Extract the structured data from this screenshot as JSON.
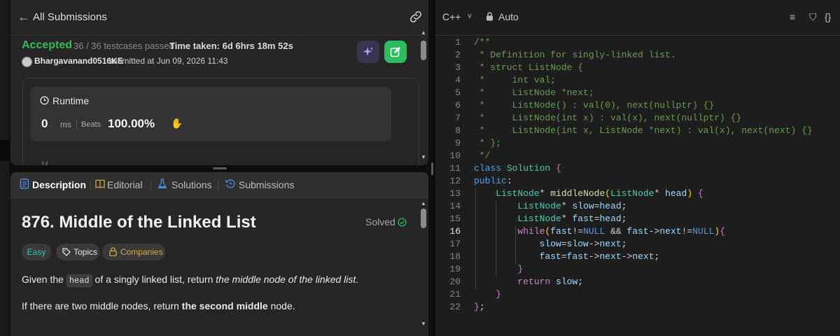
{
  "submission": {
    "back_label": "All Submissions",
    "verdict": "Accepted",
    "testcases": "36 / 36 testcases passed",
    "time_taken": "Time taken: 6d 6hrs 18m 52s",
    "username": "Bhargavanand0516KE",
    "submitted_at": "submitted at Jun 09, 2026 11:43",
    "runtime_label": "Runtime",
    "runtime_value": "0",
    "runtime_unit": "ms",
    "beats_label": "Beats",
    "beats_value": "100.00%",
    "memory_peek": "M"
  },
  "tabs": [
    {
      "label": "Description",
      "icon": "description-icon"
    },
    {
      "label": "Editorial",
      "icon": "book-icon"
    },
    {
      "label": "Solutions",
      "icon": "flask-icon"
    },
    {
      "label": "Submissions",
      "icon": "history-icon"
    }
  ],
  "problem": {
    "title": "876. Middle of the Linked List",
    "status": "Solved",
    "difficulty": "Easy",
    "topics_label": "Topics",
    "companies_label": "Companies",
    "desc1_pre": "Given the ",
    "desc1_code": "head",
    "desc1_mid": " of a singly linked list, return ",
    "desc1_em": "the middle node of the linked list",
    "desc1_post": ".",
    "desc2_pre": "If there are two middle nodes, return ",
    "desc2_bold": "the second middle",
    "desc2_post": " node."
  },
  "editor": {
    "language": "C++",
    "mode": "Auto",
    "active_line": 16,
    "lines": [
      "/**",
      " * Definition for singly-linked list.",
      " * struct ListNode {",
      " *     int val;",
      " *     ListNode *next;",
      " *     ListNode() : val(0), next(nullptr) {}",
      " *     ListNode(int x) : val(x), next(nullptr) {}",
      " *     ListNode(int x, ListNode *next) : val(x), next(next) {}",
      " * };",
      " */",
      "class Solution {",
      "public:",
      "    ListNode* middleNode(ListNode* head) {",
      "        ListNode* slow=head;",
      "        ListNode* fast=head;",
      "        while(fast!=NULL && fast->next!=NULL){",
      "            slow=slow->next;",
      "            fast=fast->next->next;",
      "        }",
      "        return slow;",
      "    }",
      "};"
    ]
  },
  "colors": {
    "accepted": "#2cbb5d",
    "easy": "#2ec5b3",
    "companies": "#d4a94a",
    "editor_bg": "#1e1e1e",
    "panel_bg": "#262626"
  }
}
